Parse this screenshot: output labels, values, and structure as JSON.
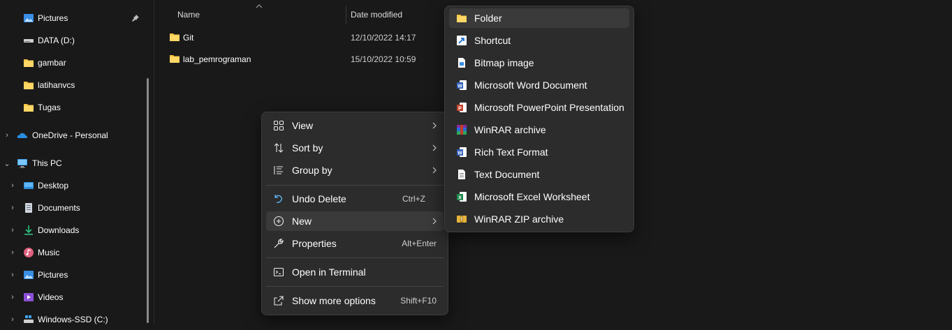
{
  "sidebar": {
    "quick_access": [
      {
        "label": "Pictures",
        "icon": "pictures-icon",
        "pinned": true
      },
      {
        "label": "DATA (D:)",
        "icon": "drive-icon"
      },
      {
        "label": "gambar",
        "icon": "folder-icon"
      },
      {
        "label": "latihanvcs",
        "icon": "folder-icon"
      },
      {
        "label": "Tugas",
        "icon": "folder-icon"
      }
    ],
    "onedrive": {
      "label": "OneDrive - Personal",
      "icon": "onedrive-icon"
    },
    "this_pc": {
      "label": "This PC",
      "icon": "computer-icon"
    },
    "this_pc_children": [
      {
        "label": "Desktop",
        "icon": "desktop-icon"
      },
      {
        "label": "Documents",
        "icon": "documents-icon"
      },
      {
        "label": "Downloads",
        "icon": "downloads-icon"
      },
      {
        "label": "Music",
        "icon": "music-icon"
      },
      {
        "label": "Pictures",
        "icon": "pictures-icon"
      },
      {
        "label": "Videos",
        "icon": "videos-icon"
      },
      {
        "label": "Windows-SSD (C:)",
        "icon": "windows-drive-icon"
      }
    ]
  },
  "file_list": {
    "columns": {
      "name": "Name",
      "date_modified": "Date modified"
    },
    "rows": [
      {
        "name": "Git",
        "date": "12/10/2022 14:17"
      },
      {
        "name": "lab_pemrograman",
        "date": "15/10/2022 10:59"
      }
    ]
  },
  "context_menu": {
    "view": "View",
    "sort_by": "Sort by",
    "group_by": "Group by",
    "undo_delete": "Undo Delete",
    "undo_shortcut": "Ctrl+Z",
    "new": "New",
    "properties": "Properties",
    "properties_shortcut": "Alt+Enter",
    "open_terminal": "Open in Terminal",
    "show_more": "Show more options",
    "show_more_shortcut": "Shift+F10"
  },
  "new_submenu": [
    {
      "label": "Folder",
      "icon": "folder-icon"
    },
    {
      "label": "Shortcut",
      "icon": "shortcut-icon"
    },
    {
      "label": "Bitmap image",
      "icon": "bitmap-icon"
    },
    {
      "label": "Microsoft Word Document",
      "icon": "word-icon"
    },
    {
      "label": "Microsoft PowerPoint Presentation",
      "icon": "powerpoint-icon"
    },
    {
      "label": "WinRAR archive",
      "icon": "winrar-icon"
    },
    {
      "label": "Rich Text Format",
      "icon": "rtf-icon"
    },
    {
      "label": "Text Document",
      "icon": "text-document-icon"
    },
    {
      "label": "Microsoft Excel Worksheet",
      "icon": "excel-icon"
    },
    {
      "label": "WinRAR ZIP archive",
      "icon": "winrar-zip-icon"
    }
  ],
  "colors": {
    "background": "#191919",
    "menu_bg": "#2c2c2c",
    "highlight": "#3a3a3a",
    "folder": "#f8c542",
    "accent_blue": "#4aa3f0"
  }
}
